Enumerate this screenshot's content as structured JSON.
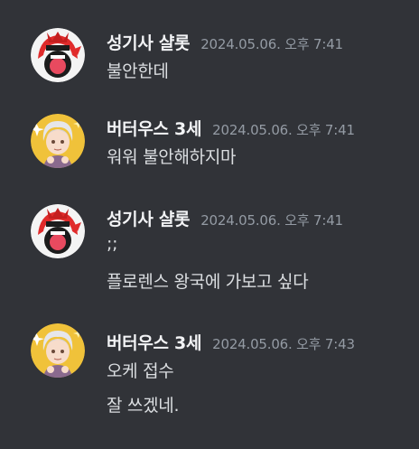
{
  "messages": [
    {
      "author": "성기사 샬롯",
      "avatar_icon": "red-helmet-knight-avatar",
      "timestamp": "2024.05.06. 오후 7:41",
      "lines": [
        "불안한데"
      ]
    },
    {
      "author": "버터우스 3세",
      "avatar_icon": "silver-hair-boy-avatar",
      "timestamp": "2024.05.06. 오후 7:41",
      "lines": [
        "워워 불안해하지마"
      ]
    },
    {
      "author": "성기사 샬롯",
      "avatar_icon": "red-helmet-knight-avatar",
      "timestamp": "2024.05.06. 오후 7:41",
      "lines": [
        ";;",
        "플로렌스 왕국에 가보고 싶다"
      ]
    },
    {
      "author": "버터우스 3세",
      "avatar_icon": "silver-hair-boy-avatar",
      "timestamp": "2024.05.06. 오후 7:43",
      "lines": [
        "오케 접수",
        "잘 쓰겠네."
      ]
    }
  ],
  "colors": {
    "background": "#313338",
    "username": "#f2f3f5",
    "timestamp": "#949ba4",
    "text": "#dbdee1"
  }
}
